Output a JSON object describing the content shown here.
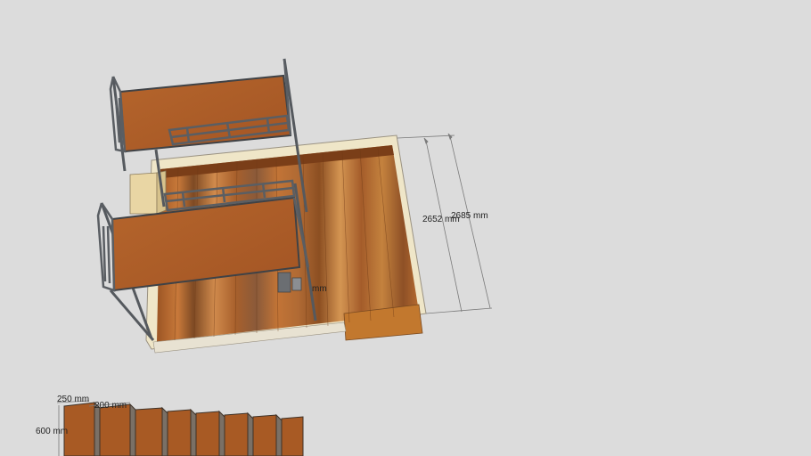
{
  "viewport": {
    "background": "#dcdcdc"
  },
  "dimensions": {
    "room_width_inner": "2652 mm",
    "room_width_outer": "2685 mm",
    "partial_label": "mm",
    "step_depth": "250 mm",
    "step_gap": "200 mm",
    "step_height": "600 mm"
  },
  "colors": {
    "wood_dark": "#8a4a1c",
    "wood_mid": "#b0622a",
    "wood_light": "#c98a4e",
    "metal": "#5a5e63",
    "wall_cream": "#efe6c8",
    "dim_line": "#777777"
  }
}
